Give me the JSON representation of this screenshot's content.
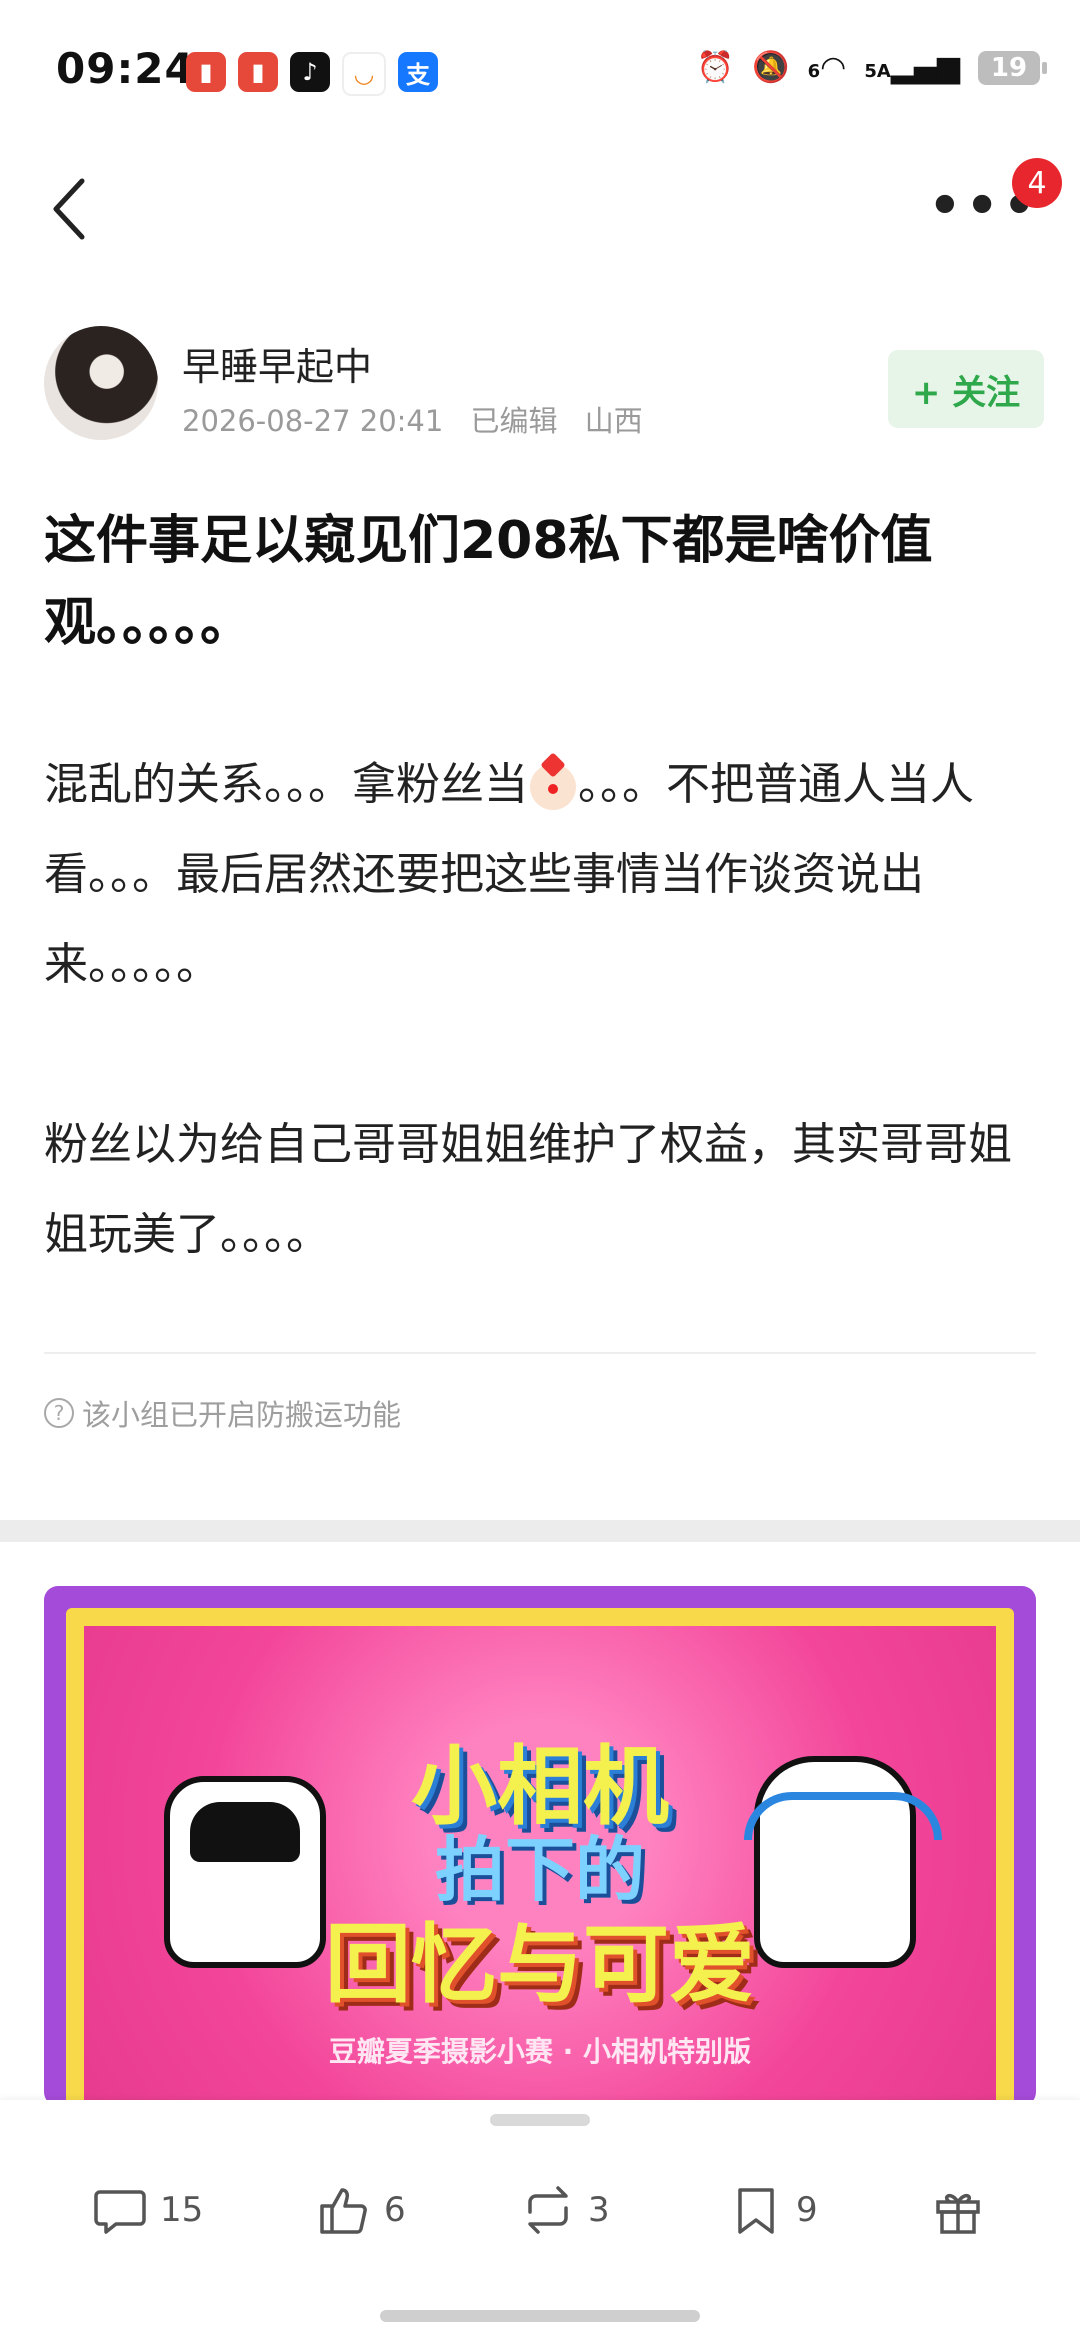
{
  "status_bar": {
    "time": "09:24",
    "battery": "19",
    "signal_label": "5A",
    "wifi_label": "6",
    "app_icons": [
      "red-app-icon",
      "red-app-icon",
      "tiktok-icon",
      "didi-icon",
      "alipay-icon"
    ],
    "alipay_char": "支"
  },
  "nav": {
    "back_icon": "chevron-left-icon",
    "more_icon": "more-dots-icon",
    "badge_count": "4"
  },
  "author": {
    "name": "早睡早起中",
    "date": "2026-08-27 20:41",
    "edited": "已编辑",
    "location": "山西",
    "follow_label": "+ 关注"
  },
  "post": {
    "title": "这件事足以窥见们208私下都是啥价值观。。。。。",
    "para1_before": "混乱的关系。。。拿粉丝当",
    "para1_emoji": "clown-emoji",
    "para1_after": "。。。不把普通人当人看。。。最后居然还要把这些事情当作谈资说出来。。。。。",
    "para2": "粉丝以为给自己哥哥姐姐维护了权益，其实哥哥姐姐玩美了。。。。"
  },
  "notice": {
    "icon": "question-circle-icon",
    "text": "该小组已开启防搬运功能"
  },
  "banner": {
    "title_line1": "小相机",
    "title_line2": "拍下的",
    "title_line3": "回忆与可爱",
    "subtitle": "豆瓣夏季摄影小赛 · 小相机特别版"
  },
  "actions": {
    "comment_count": "15",
    "like_count": "6",
    "repost_count": "3",
    "bookmark_count": "9",
    "gift_icon": "gift-icon"
  },
  "colors": {
    "accent_green": "#2ea84a",
    "badge_red": "#e8262d",
    "banner_purple": "#a54bd9",
    "banner_pink": "#f3469a"
  }
}
